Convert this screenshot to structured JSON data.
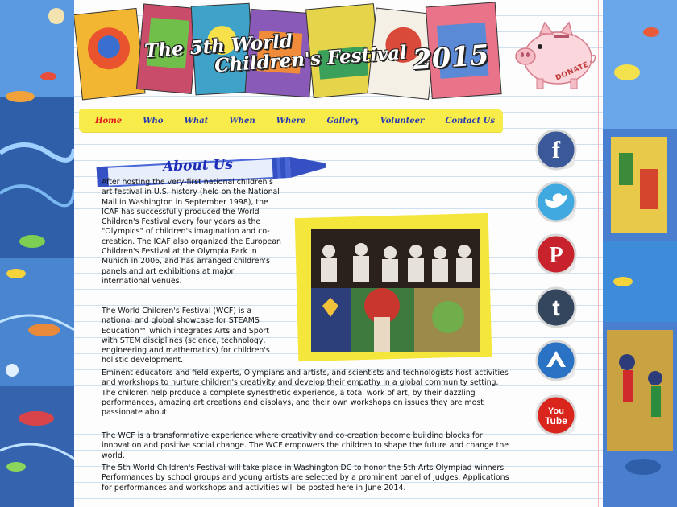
{
  "header": {
    "title_line1": "The 5th World",
    "title_line2": "Children's Festival",
    "year": "2015"
  },
  "donate": {
    "label": "DONATE"
  },
  "nav": {
    "items": [
      {
        "label": "Home",
        "active": true
      },
      {
        "label": "Who",
        "active": false
      },
      {
        "label": "What",
        "active": false
      },
      {
        "label": "When",
        "active": false
      },
      {
        "label": "Where",
        "active": false
      },
      {
        "label": "Gallery",
        "active": false
      },
      {
        "label": "Volunteer",
        "active": false
      },
      {
        "label": "Contact Us",
        "active": false
      }
    ]
  },
  "section": {
    "heading": "About Us"
  },
  "paragraphs": [
    "After hosting the very-first national children's art festival in U.S. history (held on the National Mall in Washington in September 1998), the ICAF has successfully produced the World Children's Festival every four years as the \"Olympics\" of children's imagination and co-creation. The ICAF also organized the European Children's Festival at the Olympia Park in Munich in 2006, and has arranged children's panels and art exhibitions at major international venues.",
    "The World Children's Festival (WCF) is a national and global showcase for STEAMS Education℠ which integrates Arts and Sport with STEM disciplines (science, technology, engineering and mathematics) for children's holistic development.",
    "Eminent educators and field experts, Olympians and artists, and scientists and technologists host activities and workshops to nurture children's creativity and develop their empathy in a global community setting. The children help produce a complete synesthetic experience, a total work of art, by their dazzling performances, amazing art creations and displays, and their own workshops on issues they are most passionate about.",
    "The WCF is a transformative experience where creativity and co-creation become building blocks for innovation and positive social change. The WCF empowers the children to shape the future and change the world.",
    "The 5th World Children's Festival will take place in Washington DC to honor the 5th Arts Olympiad winners. Performances by school groups and young artists are selected by a prominent panel of judges. Applications for performances and workshops and activities will be posted here in June 2014."
  ],
  "social": [
    {
      "name": "facebook",
      "icon": "facebook-icon",
      "glyph": "f",
      "color": "#3b5998"
    },
    {
      "name": "twitter",
      "icon": "twitter-icon",
      "glyph": "t",
      "color": "#3fa9e0"
    },
    {
      "name": "pinterest",
      "icon": "pinterest-icon",
      "glyph": "P",
      "color": "#c8232c"
    },
    {
      "name": "tumblr",
      "icon": "tumblr-icon",
      "glyph": "t",
      "color": "#34465d"
    },
    {
      "name": "bookmark",
      "icon": "chevron-up-icon",
      "glyph": "^",
      "color": "#2a73c4"
    },
    {
      "name": "youtube",
      "icon": "youtube-icon",
      "glyph": "You Tube",
      "color": "#d9251c"
    }
  ],
  "colors": {
    "nav_bg": "#f7ec4a",
    "nav_text": "#2a3bb0",
    "nav_active": "#e21c1c",
    "crayon": "#4a68d8",
    "heading": "#1c2cb7",
    "photo_frame": "#f5e63c"
  }
}
